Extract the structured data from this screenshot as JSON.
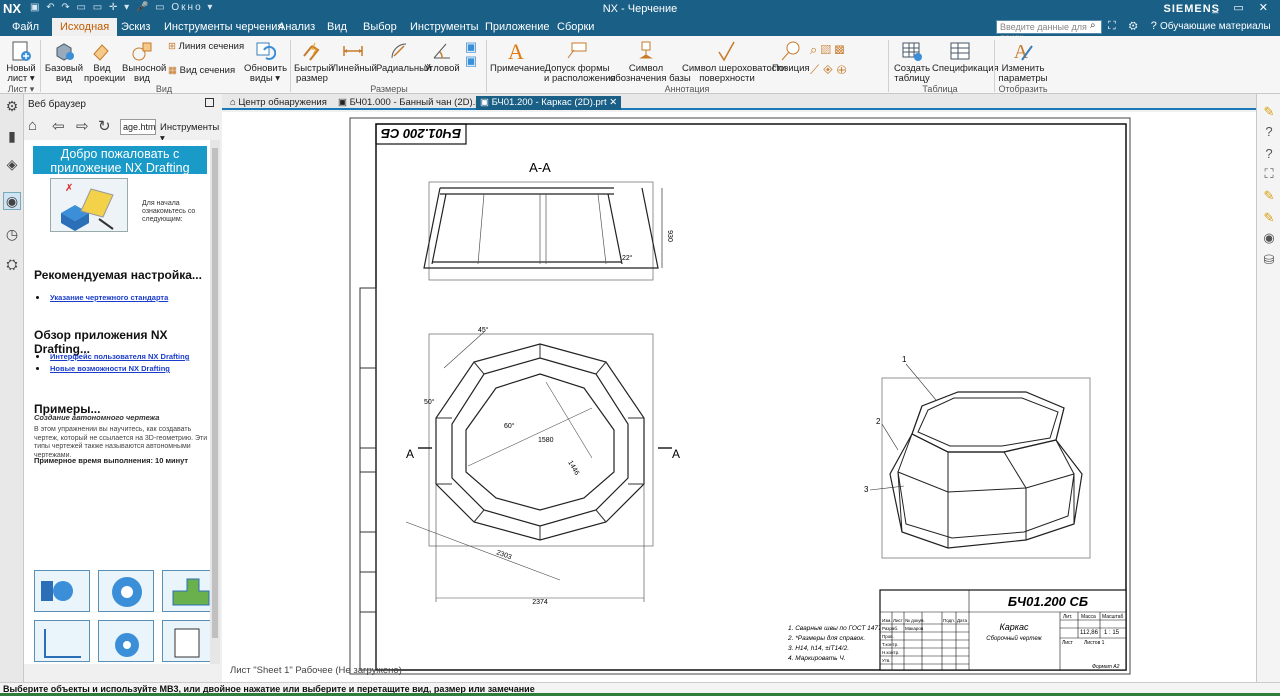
{
  "app": {
    "logo": "NX",
    "window_title": "NX - Черчение",
    "brand": "SIEMENS",
    "window_menu": "Окно",
    "window_controls": "_ ▭ ✕"
  },
  "menu": {
    "items": [
      "Файл",
      "Исходная",
      "Эскиз",
      "Инструменты черчения",
      "Анализ",
      "Вид",
      "Выбор",
      "Инструменты",
      "Приложение",
      "Сборки"
    ],
    "search_placeholder": "Введите данные для поиск",
    "learning": "Обучающие материалы"
  },
  "ribbon": {
    "buttons": [
      {
        "label": "Новый\nлист ▾",
        "icon": "new-sheet-icon"
      },
      {
        "label": "Базовый\nвид",
        "icon": "base-view-icon"
      },
      {
        "label": "Вид\nпроекции",
        "icon": "projection-view-icon"
      },
      {
        "label": "Выносной\nвид",
        "icon": "detail-view-icon"
      },
      {
        "label": "Линия сечения",
        "icon": "section-line-icon"
      },
      {
        "label": "Вид сечения",
        "icon": "section-view-icon"
      },
      {
        "label": "Обновить\nвиды ▾",
        "icon": "update-views-icon"
      },
      {
        "label": "Быстрый\nразмер",
        "icon": "rapid-dimension-icon"
      },
      {
        "label": "Линейный",
        "icon": "linear-dimension-icon"
      },
      {
        "label": "Радиальный",
        "icon": "radial-dimension-icon"
      },
      {
        "label": "Угловой",
        "icon": "angular-dimension-icon"
      },
      {
        "label": "Примечание",
        "icon": "note-icon"
      },
      {
        "label": "Допуск формы\nи расположения",
        "icon": "gdt-icon"
      },
      {
        "label": "Символ\nобозначения базы",
        "icon": "datum-symbol-icon"
      },
      {
        "label": "Символ шероховатости\nповерхности",
        "icon": "surface-finish-icon"
      },
      {
        "label": "Позиция",
        "icon": "balloon-icon"
      },
      {
        "label": "Создать\nтаблицу",
        "icon": "create-table-icon"
      },
      {
        "label": "Спецификация",
        "icon": "parts-list-icon"
      },
      {
        "label": "Изменить\nпараметры",
        "icon": "edit-settings-icon"
      }
    ],
    "groups": [
      "Лист ▾",
      "Вид",
      "Размеры",
      "Аннотация",
      "Таблица",
      "Отобразить ▾"
    ]
  },
  "web_browser": {
    "title": "Веб браузер",
    "url": "age.html",
    "tools": "Инструменты ▾",
    "welcome": "Добро пожаловать с приложение NX Drafting",
    "intro": "Для начала ознакомьтесь со следующим:",
    "h_setup": "Рекомендуемая настройка...",
    "link_std": "Указание чертежного стандарта",
    "h_overview": "Обзор приложения NX Drafting...",
    "link_ui": "Интерфейс пользователя NX Drafting",
    "link_new": "Новые возможности NX Drafting",
    "h_examples": "Примеры...",
    "ex_sub": "Создание автономного чертежа",
    "ex_text": "В этом упражнении вы научитесь, как создавать чертеж, который не ссылается на 3D-геометрию. Эти типы чертежей также называются автономными чертежами.",
    "ex_time": "Примерное время выполнения: 10 минут"
  },
  "tabs": [
    {
      "label": "Центр обнаружения",
      "active": false
    },
    {
      "label": "БЧ01.000 - Банный чан (2D).prt",
      "active": false
    },
    {
      "label": "БЧ01.200 - Каркас (2D).prt",
      "active": true
    }
  ],
  "drawing": {
    "stamp_rotated": "БЧ01.200 СБ",
    "section_label": "А-А",
    "arrow_a": "А",
    "dims": {
      "height": "930",
      "angle": "22°",
      "side": "1580",
      "diag": "2303",
      "width": "2374",
      "d45": "45°",
      "d50": "50°",
      "d60": "60°",
      "dia": "1446"
    },
    "balloons": [
      "1",
      "2",
      "3"
    ],
    "notes": [
      "1. Сварные швы по ГОСТ 14771-76.",
      "2. *Размеры для справок.",
      "3. H14, h14, ±IT14/2.",
      "4. Маркировать Ч."
    ],
    "title_block": {
      "code": "БЧ01.200 СБ",
      "name": "Каркас",
      "subname": "Сборочный чертеж",
      "col_lit": "Лит.",
      "col_mass": "Масса",
      "col_scale": "Масштаб",
      "mass": "112,86",
      "scale": "1 : 15",
      "sheet": "Лист",
      "sheets": "Листов 1",
      "format": "Формат А2",
      "rows": [
        "Изм.",
        "Разраб.",
        "Пров.",
        "Т.контр.",
        "Н.контр.",
        "Утв."
      ],
      "hdrs": [
        "Лист",
        "№ докум.",
        "Подп.",
        "Дата"
      ],
      "engineer": "Макаров"
    },
    "sheet_status": "Лист \"Sheet 1\" Рабочее (Не загружено)"
  },
  "status": "Выберите объекты и используйте MB3, или двойное нажатие или выберите и перетащите вид, размер или замечание"
}
